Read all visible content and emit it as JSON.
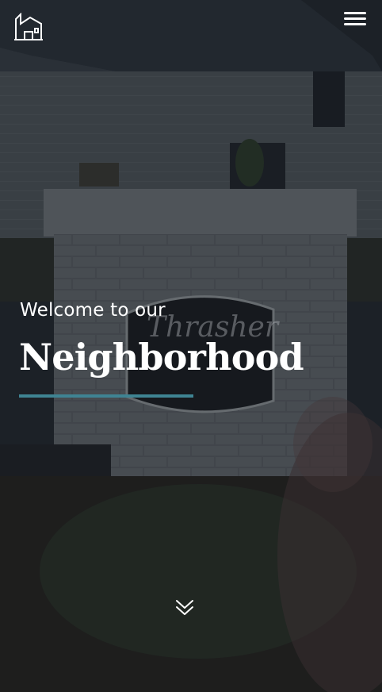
{
  "header": {
    "logo_icon": "house-outline-icon",
    "menu_icon": "hamburger-menu-icon"
  },
  "hero": {
    "kicker": "Welcome to our",
    "headline": "Neighborhood",
    "sign_text": "Thrasher",
    "accent_color": "#3f8493",
    "scroll_icon": "double-chevron-down-icon"
  }
}
